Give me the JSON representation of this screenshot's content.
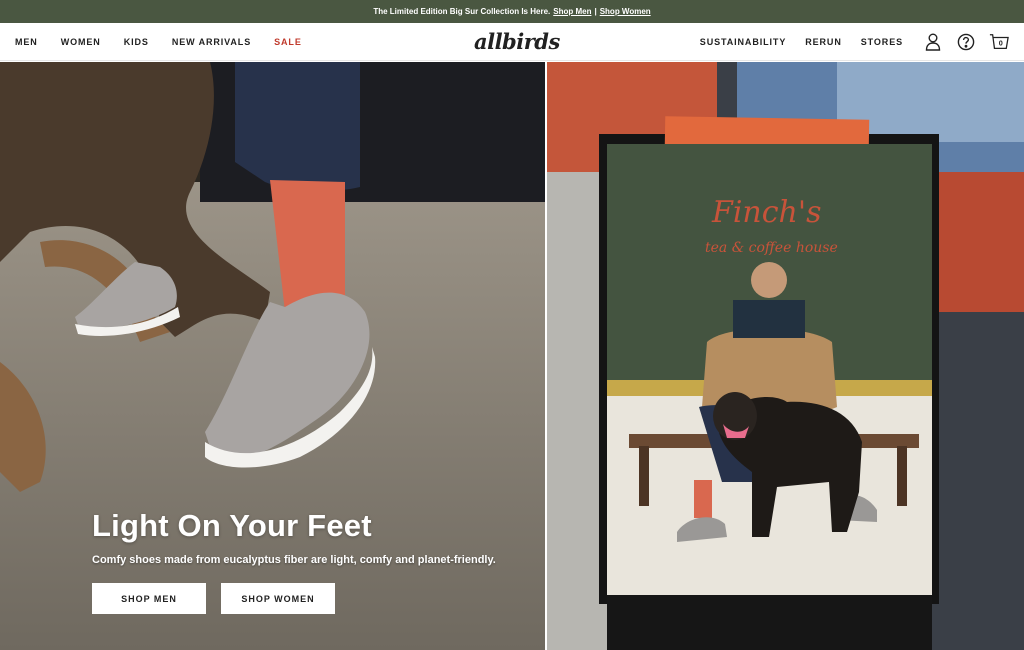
{
  "promo": {
    "text": "The Limited Edition Big Sur Collection Is Here.",
    "link_men": "Shop Men",
    "separator": "|",
    "link_women": "Shop Women"
  },
  "nav": {
    "left": [
      "MEN",
      "WOMEN",
      "KIDS",
      "NEW ARRIVALS",
      "SALE"
    ],
    "logo": "allbirds",
    "right": [
      "SUSTAINABILITY",
      "RERUN",
      "STORES"
    ],
    "icons": [
      "account-icon",
      "help-icon",
      "cart-icon"
    ],
    "cart_count": "0"
  },
  "hero": {
    "title": "Light On Your Feet",
    "subtitle": "Comfy shoes made from eucalyptus fiber are light, comfy and planet-friendly.",
    "button_men": "SHOP MEN",
    "button_women": "SHOP WOMEN",
    "storefront_sign_line1": "Finch's",
    "storefront_sign_line2": "tea & coffee house"
  },
  "colors": {
    "promo_bg": "#4a5741",
    "sale": "#c0392b",
    "text": "#212121",
    "sock": "#d9684f",
    "shoe": "#a8a4a2"
  }
}
